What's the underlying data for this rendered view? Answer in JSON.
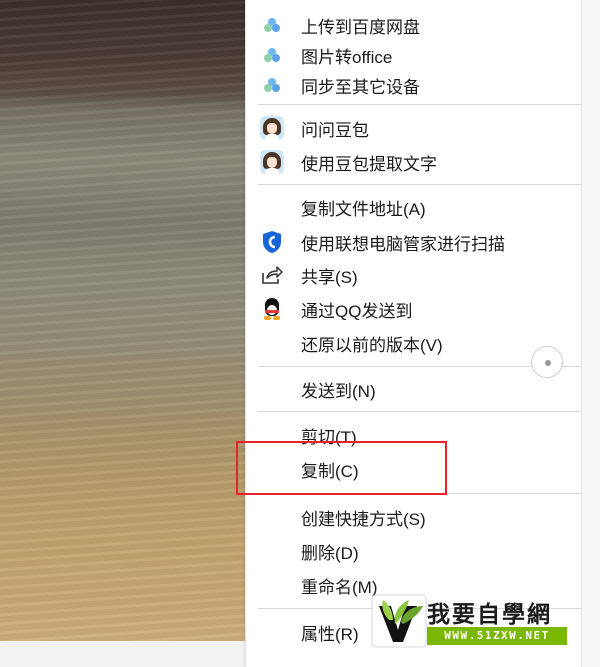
{
  "menu": {
    "group1": [
      {
        "label": "上传到百度网盘",
        "icon": "baidu-netdisk-icon"
      },
      {
        "label": "图片转office",
        "icon": "baidu-netdisk-icon"
      },
      {
        "label": "同步至其它设备",
        "icon": "baidu-netdisk-icon"
      }
    ],
    "group2": [
      {
        "label": "问问豆包",
        "icon": "doubao-avatar-icon"
      },
      {
        "label": "使用豆包提取文字",
        "icon": "doubao-avatar-icon"
      }
    ],
    "group3": [
      {
        "label": "复制文件地址(A)",
        "icon": ""
      },
      {
        "label": "使用联想电脑管家进行扫描",
        "icon": "lenovo-shield-icon"
      },
      {
        "label": "共享(S)",
        "icon": "share-icon"
      },
      {
        "label": "通过QQ发送到",
        "icon": "qq-penguin-icon"
      },
      {
        "label": "还原以前的版本(V)",
        "icon": ""
      }
    ],
    "group4": [
      {
        "label": "发送到(N)",
        "icon": ""
      }
    ],
    "group5": [
      {
        "label": "剪切(T)",
        "icon": ""
      },
      {
        "label": "复制(C)",
        "icon": ""
      }
    ],
    "group6": [
      {
        "label": "创建快捷方式(S)",
        "icon": ""
      },
      {
        "label": "删除(D)",
        "icon": ""
      },
      {
        "label": "重命名(M)",
        "icon": ""
      }
    ],
    "group7": [
      {
        "label": "属性(R)",
        "icon": ""
      }
    ]
  },
  "highlight": {
    "target": "复制(C)",
    "color": "#e8232a"
  },
  "watermark": {
    "title": "我要自學網",
    "url": "WWW.51ZXW.NET",
    "accent": "#7ab800"
  }
}
